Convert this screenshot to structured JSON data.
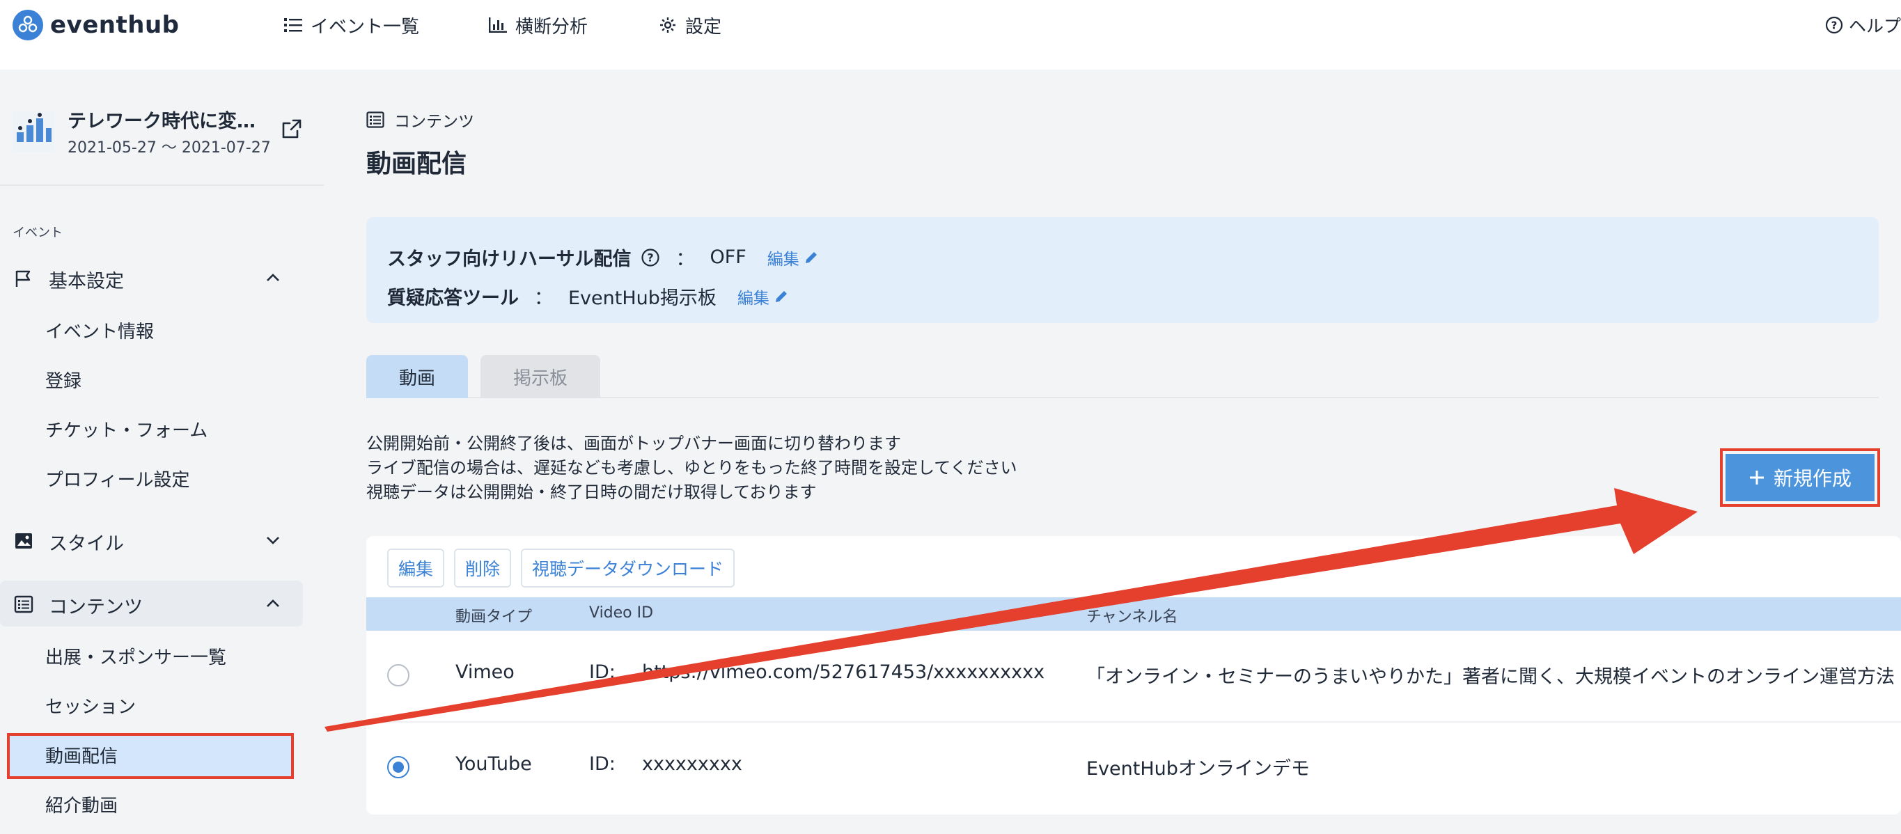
{
  "app": {
    "name": "eventhub"
  },
  "nav": {
    "items": [
      {
        "label": "イベント一覧",
        "icon": "list-icon"
      },
      {
        "label": "横断分析",
        "icon": "chart-icon"
      },
      {
        "label": "設定",
        "icon": "gear-icon"
      }
    ],
    "help": "ヘルプ"
  },
  "event": {
    "title": "テレワーク時代に変…",
    "dates": "2021-05-27 ～ 2021-07-27"
  },
  "sidebar": {
    "section_label": "イベント",
    "groups": [
      {
        "label": "基本設定",
        "expanded": true
      },
      {
        "label": "スタイル",
        "expanded": false
      },
      {
        "label": "コンテンツ",
        "expanded": true
      }
    ],
    "basic_items": [
      "イベント情報",
      "登録",
      "チケット・フォーム",
      "プロフィール設定"
    ],
    "content_items": [
      "出展・スポンサー一覧",
      "セッション",
      "動画配信",
      "紹介動画"
    ],
    "active_item": "動画配信"
  },
  "main": {
    "breadcrumb": "コンテンツ",
    "title": "動画配信",
    "settings": {
      "rehearsal_label": "スタッフ向けリハーサル配信",
      "rehearsal_value": "OFF",
      "qa_label": "質疑応答ツール",
      "qa_value": "EventHub掲示板",
      "colon": "：",
      "edit_label": "編集"
    },
    "tabs": [
      {
        "label": "動画",
        "active": true
      },
      {
        "label": "掲示板",
        "active": false
      }
    ],
    "notes": [
      "公開開始前・公開終了後は、画面がトップバナー画面に切り替わります",
      "ライブ配信の場合は、遅延なども考慮し、ゆとりをもった終了時間を設定してください",
      "視聴データは公開開始・終了日時の間だけ取得しております"
    ],
    "new_button": "新規作成",
    "table": {
      "actions": [
        "編集",
        "削除",
        "視聴データダウンロード"
      ],
      "headers": {
        "type": "動画タイプ",
        "video_id": "Video ID",
        "channel": "チャンネル名"
      },
      "rows": [
        {
          "selected": false,
          "type": "Vimeo",
          "id_label": "ID:",
          "id": "https://vimeo.com/527617453/xxxxxxxxxx",
          "channel": "「オンライン・セミナーのうまいやりかた」著者に聞く、大規模イベントのオンライン運営方法"
        },
        {
          "selected": true,
          "type": "YouTube",
          "id_label": "ID:",
          "id": "xxxxxxxxx",
          "channel": "EventHubオンラインデモ"
        }
      ]
    }
  },
  "colors": {
    "accent": "#3b82d6",
    "highlight": "#e4402d",
    "button": "#4c95dd",
    "header_bg": "#c4dcf6"
  }
}
